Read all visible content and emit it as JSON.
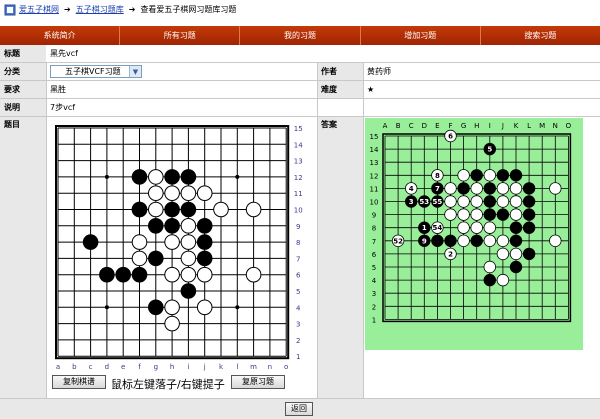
{
  "breadcrumb": {
    "home": "爱五子棋网",
    "library": "五子棋习题库",
    "current": "查看爱五子棋网习题库习题"
  },
  "nav": [
    {
      "label": "系统简介"
    },
    {
      "label": "所有习题"
    },
    {
      "label": "我的习题"
    },
    {
      "label": "增加习题"
    },
    {
      "label": "搜索习题"
    }
  ],
  "form": {
    "title_label": "标题",
    "title_value": "黑先vcf",
    "category_label": "分类",
    "category_value": "五子棋VCF习题",
    "author_label": "作者",
    "author_value": "黄药师",
    "req_label": "要求",
    "req_value": "黑胜",
    "difficulty_label": "难度",
    "difficulty_value": "★",
    "desc_label": "说明",
    "desc_value": "7步vcf",
    "problem_label": "题目",
    "answer_label": "答案"
  },
  "board_left": {
    "cols": [
      "a",
      "b",
      "c",
      "d",
      "e",
      "f",
      "g",
      "h",
      "i",
      "j",
      "k",
      "l",
      "m",
      "n",
      "o"
    ],
    "rows": [
      "15",
      "14",
      "13",
      "12",
      "11",
      "10",
      "9",
      "8",
      "7",
      "6",
      "5",
      "4",
      "3",
      "2",
      "1"
    ],
    "black": [
      [
        6,
        12
      ],
      [
        8,
        12
      ],
      [
        9,
        12
      ],
      [
        8,
        10
      ],
      [
        6,
        10
      ],
      [
        9,
        10
      ],
      [
        7,
        9
      ],
      [
        8,
        9
      ],
      [
        10,
        9
      ],
      [
        10,
        8
      ],
      [
        3,
        8
      ],
      [
        7,
        7
      ],
      [
        10,
        7
      ],
      [
        4,
        6
      ],
      [
        5,
        6
      ],
      [
        6,
        6
      ],
      [
        9,
        5
      ],
      [
        7,
        4
      ]
    ],
    "white": [
      [
        7,
        12
      ],
      [
        8,
        11
      ],
      [
        9,
        11
      ],
      [
        7,
        11
      ],
      [
        10,
        11
      ],
      [
        6,
        10
      ],
      [
        7,
        10
      ],
      [
        11,
        10
      ],
      [
        13,
        10
      ],
      [
        9,
        9
      ],
      [
        6,
        8
      ],
      [
        8,
        8
      ],
      [
        9,
        8
      ],
      [
        6,
        7
      ],
      [
        9,
        7
      ],
      [
        8,
        6
      ],
      [
        9,
        6
      ],
      [
        10,
        6
      ],
      [
        13,
        6
      ],
      [
        8,
        4
      ],
      [
        10,
        4
      ],
      [
        8,
        3
      ]
    ]
  },
  "board_right": {
    "cols": [
      "A",
      "B",
      "C",
      "D",
      "E",
      "F",
      "G",
      "H",
      "I",
      "J",
      "K",
      "L",
      "M",
      "N",
      "O"
    ],
    "rows": [
      "15",
      "14",
      "13",
      "12",
      "11",
      "10",
      "9",
      "8",
      "7",
      "6",
      "5",
      "4",
      "3",
      "2",
      "1"
    ],
    "black": [
      {
        "c": 9,
        "r": 14,
        "n": "5"
      },
      {
        "c": 5,
        "r": 11,
        "n": "7"
      },
      {
        "c": 3,
        "r": 10,
        "n": "3"
      },
      {
        "c": 4,
        "r": 10,
        "n": "53"
      },
      {
        "c": 5,
        "r": 10,
        "n": "55"
      },
      {
        "c": 4,
        "r": 8,
        "n": "1"
      },
      {
        "c": 4,
        "r": 7,
        "n": "9"
      },
      {
        "c": 8,
        "r": 12,
        "n": ""
      },
      {
        "c": 10,
        "r": 12,
        "n": ""
      },
      {
        "c": 11,
        "r": 12,
        "n": ""
      },
      {
        "c": 12,
        "r": 11,
        "n": ""
      },
      {
        "c": 9,
        "r": 11,
        "n": ""
      },
      {
        "c": 7,
        "r": 11,
        "n": ""
      },
      {
        "c": 9,
        "r": 10,
        "n": ""
      },
      {
        "c": 12,
        "r": 10,
        "n": ""
      },
      {
        "c": 10,
        "r": 9,
        "n": ""
      },
      {
        "c": 9,
        "r": 9,
        "n": ""
      },
      {
        "c": 12,
        "r": 9,
        "n": ""
      },
      {
        "c": 12,
        "r": 8,
        "n": ""
      },
      {
        "c": 11,
        "r": 8,
        "n": ""
      },
      {
        "c": 8,
        "r": 7,
        "n": ""
      },
      {
        "c": 11,
        "r": 7,
        "n": ""
      },
      {
        "c": 5,
        "r": 7,
        "n": ""
      },
      {
        "c": 6,
        "r": 7,
        "n": ""
      },
      {
        "c": 12,
        "r": 6,
        "n": ""
      },
      {
        "c": 11,
        "r": 5,
        "n": ""
      },
      {
        "c": 9,
        "r": 4,
        "n": ""
      }
    ],
    "white": [
      {
        "c": 6,
        "r": 15,
        "n": "6"
      },
      {
        "c": 3,
        "r": 11,
        "n": "4"
      },
      {
        "c": 5,
        "r": 12,
        "n": "8"
      },
      {
        "c": 5,
        "r": 8,
        "n": "54"
      },
      {
        "c": 2,
        "r": 7,
        "n": "52"
      },
      {
        "c": 6,
        "r": 6,
        "n": "2"
      },
      {
        "c": 7,
        "r": 12,
        "n": ""
      },
      {
        "c": 9,
        "r": 12,
        "n": ""
      },
      {
        "c": 10,
        "r": 11,
        "n": ""
      },
      {
        "c": 11,
        "r": 11,
        "n": ""
      },
      {
        "c": 8,
        "r": 11,
        "n": ""
      },
      {
        "c": 6,
        "r": 11,
        "n": ""
      },
      {
        "c": 7,
        "r": 10,
        "n": ""
      },
      {
        "c": 8,
        "r": 10,
        "n": ""
      },
      {
        "c": 10,
        "r": 10,
        "n": ""
      },
      {
        "c": 11,
        "r": 10,
        "n": ""
      },
      {
        "c": 14,
        "r": 11,
        "n": ""
      },
      {
        "c": 6,
        "r": 10,
        "n": ""
      },
      {
        "c": 7,
        "r": 9,
        "n": ""
      },
      {
        "c": 8,
        "r": 9,
        "n": ""
      },
      {
        "c": 11,
        "r": 9,
        "n": ""
      },
      {
        "c": 6,
        "r": 9,
        "n": ""
      },
      {
        "c": 7,
        "r": 8,
        "n": ""
      },
      {
        "c": 8,
        "r": 8,
        "n": ""
      },
      {
        "c": 9,
        "r": 8,
        "n": ""
      },
      {
        "c": 7,
        "r": 7,
        "n": ""
      },
      {
        "c": 9,
        "r": 7,
        "n": ""
      },
      {
        "c": 10,
        "r": 7,
        "n": ""
      },
      {
        "c": 14,
        "r": 7,
        "n": ""
      },
      {
        "c": 10,
        "r": 6,
        "n": ""
      },
      {
        "c": 11,
        "r": 6,
        "n": ""
      },
      {
        "c": 9,
        "r": 5,
        "n": ""
      },
      {
        "c": 10,
        "r": 4,
        "n": ""
      }
    ]
  },
  "buttons": {
    "copy": "复制棋谱",
    "hint": "鼠标左键落子/右键提子",
    "reset": "复原习题",
    "back": "返回"
  },
  "colors": {
    "nav": "#b8300a",
    "answer_bg": "#99ee99",
    "label_bg": "#e8e8e8"
  }
}
